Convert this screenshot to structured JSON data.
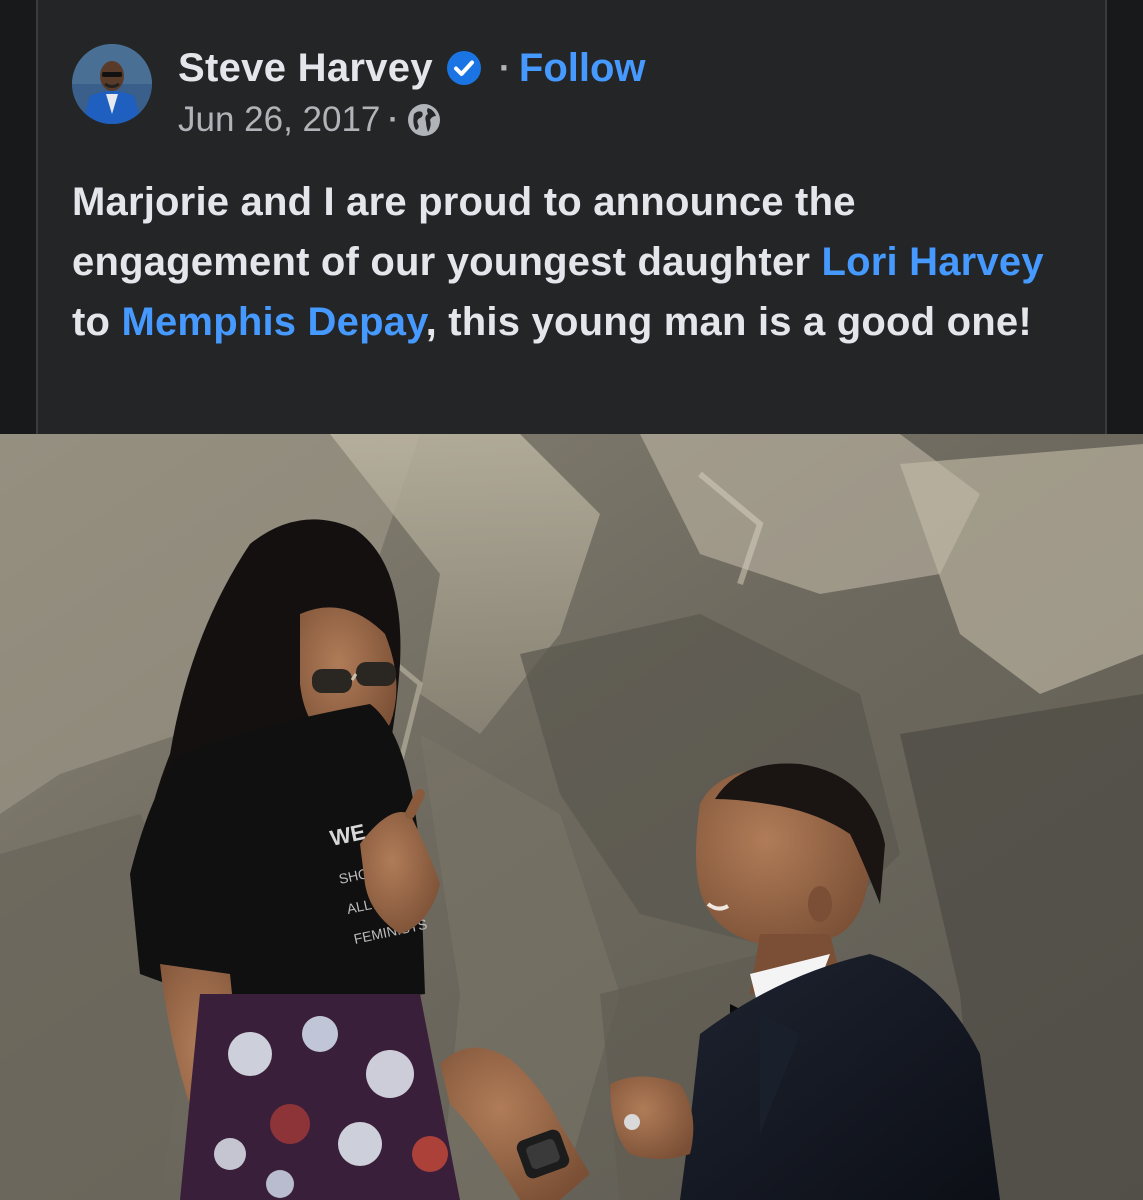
{
  "post": {
    "author": {
      "name": "Steve Harvey",
      "verified_icon": "verified-badge-icon",
      "avatar_icon": "profile-avatar"
    },
    "separator": "·",
    "follow_label": "Follow",
    "date": "Jun 26, 2017",
    "audience_icon": "globe-icon",
    "text": {
      "part1": "Marjorie and I are proud to announce the engagement of our youngest daughter ",
      "mention1": "Lori Harvey",
      "part2": " to ",
      "mention2": "Memphis Depay",
      "part3": ", this young man is a good one!"
    },
    "photo": {
      "shirt_text": "WE SHOULD ALL BE FEMINISTS"
    }
  },
  "colors": {
    "background": "#18191a",
    "card": "#242526",
    "text_primary": "#e4e6eb",
    "text_secondary": "#b0b3b8",
    "link": "#4599ff",
    "verified": "#1b74e4"
  }
}
